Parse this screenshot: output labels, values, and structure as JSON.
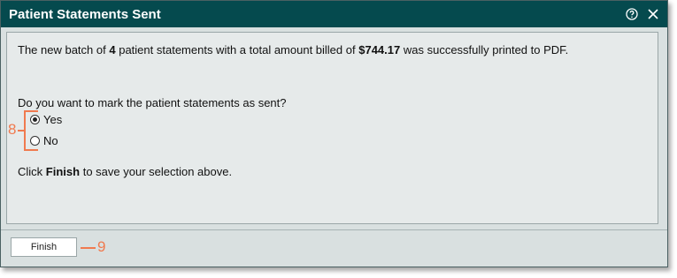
{
  "dialog": {
    "title": "Patient Statements Sent",
    "help_icon": "help-circle-icon",
    "close_icon": "close-icon"
  },
  "message": {
    "part1": "The new batch of",
    "count": "4",
    "part2": "patient statements with a total amount billed of",
    "amount": "$744.17",
    "part3": "was successfully printed to PDF."
  },
  "question": "Do you want to mark the patient statements as sent?",
  "options": [
    {
      "label": "Yes",
      "checked": true
    },
    {
      "label": "No",
      "checked": false
    }
  ],
  "instruction": {
    "prefix": "Click",
    "bold": "Finish",
    "suffix": "to save your selection above."
  },
  "buttons": {
    "finish_label": "Finish"
  },
  "callouts": {
    "options_callout": "8",
    "finish_callout": "9",
    "color": "#f07a4f"
  },
  "colors": {
    "titlebar": "#054a4e",
    "dialog_bg": "#d9e0e0",
    "content_bg": "#e6eaea"
  }
}
